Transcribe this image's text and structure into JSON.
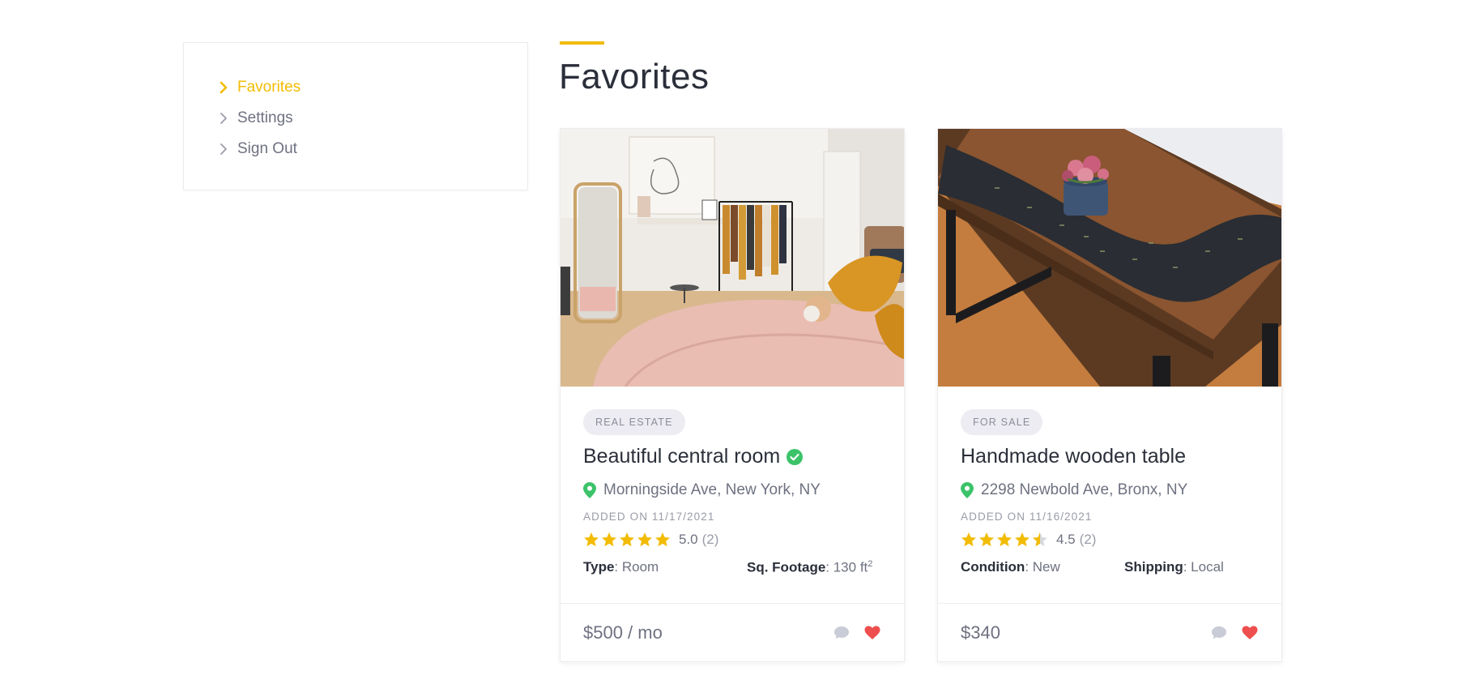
{
  "sidebar": {
    "items": [
      {
        "label": "Favorites",
        "active": true
      },
      {
        "label": "Settings",
        "active": false
      },
      {
        "label": "Sign Out",
        "active": false
      }
    ]
  },
  "page": {
    "title": "Favorites"
  },
  "colors": {
    "accent": "#f2bc05",
    "verified": "#3cc36a",
    "heart": "#ee4e4e",
    "pin": "#3cc36a"
  },
  "cards": [
    {
      "image": "bedroom-photo",
      "badge": "REAL ESTATE",
      "title": "Beautiful central room",
      "verified": true,
      "location": "Morningside Ave, New York, NY",
      "added": "ADDED ON 11/17/2021",
      "rating": "5.0",
      "rating_value": 5.0,
      "rating_count": "(2)",
      "meta1_label": "Type",
      "meta1_value": ": Room",
      "meta2_label": "Sq. Footage",
      "meta2_value": ": 130 ft",
      "meta2_sup": "2",
      "price": "$500 / mo"
    },
    {
      "image": "wooden-table-photo",
      "badge": "FOR SALE",
      "title": "Handmade wooden table",
      "verified": false,
      "location": "2298 Newbold Ave, Bronx, NY",
      "added": "ADDED ON 11/16/2021",
      "rating": "4.5",
      "rating_value": 4.5,
      "rating_count": "(2)",
      "meta1_label": "Condition",
      "meta1_value": ": New",
      "meta2_label": "Shipping",
      "meta2_value": ": Local",
      "meta2_sup": "",
      "price": "$340"
    }
  ]
}
